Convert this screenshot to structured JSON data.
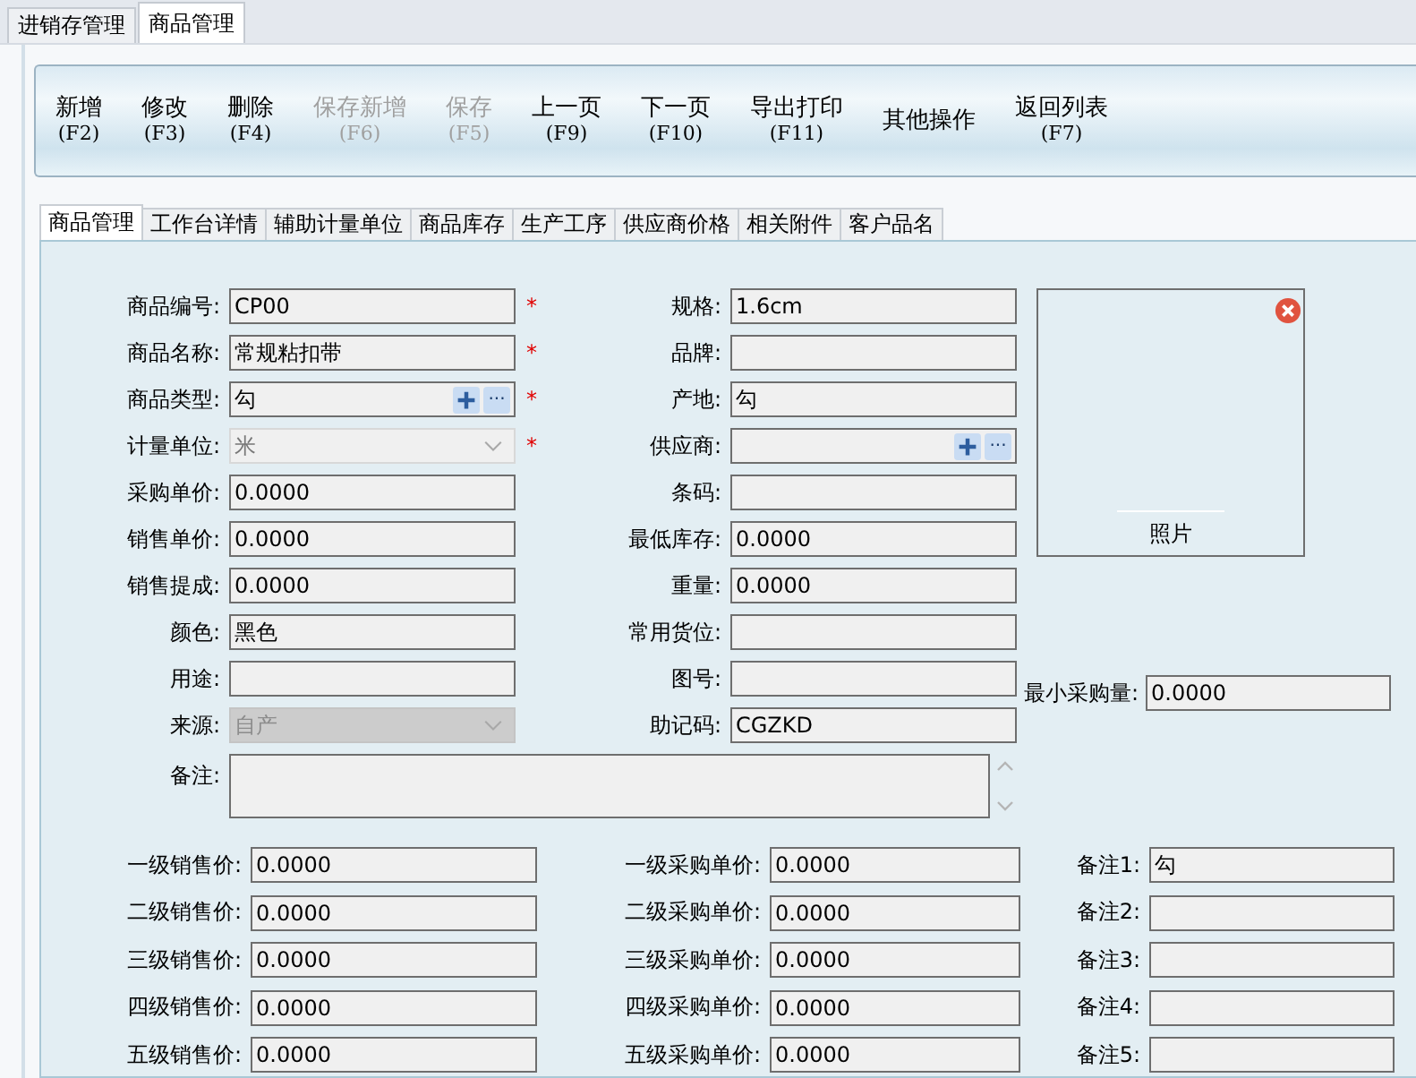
{
  "top_tabs": [
    {
      "label": "进销存管理",
      "selected": false
    },
    {
      "label": "商品管理",
      "selected": true
    }
  ],
  "toolbar": [
    {
      "label": "新增",
      "shortcut": "(F2)",
      "disabled": false
    },
    {
      "label": "修改",
      "shortcut": "(F3)",
      "disabled": false
    },
    {
      "label": "删除",
      "shortcut": "(F4)",
      "disabled": false
    },
    {
      "label": "保存新增",
      "shortcut": "(F6)",
      "disabled": true
    },
    {
      "label": "保存",
      "shortcut": "(F5)",
      "disabled": true
    },
    {
      "label": "上一页",
      "shortcut": "(F9)",
      "disabled": false
    },
    {
      "label": "下一页",
      "shortcut": "(F10)",
      "disabled": false
    },
    {
      "label": "导出打印",
      "shortcut": "(F11)",
      "disabled": false
    },
    {
      "label": "其他操作",
      "disabled": false
    },
    {
      "label": "返回列表",
      "shortcut": "(F7)",
      "disabled": false
    }
  ],
  "tabs": [
    {
      "label": "商品管理",
      "selected": true
    },
    {
      "label": "工作台详情",
      "selected": false
    },
    {
      "label": "辅助计量单位",
      "selected": false
    },
    {
      "label": "商品库存",
      "selected": false
    },
    {
      "label": "生产工序",
      "selected": false
    },
    {
      "label": "供应商价格",
      "selected": false
    },
    {
      "label": "相关附件",
      "selected": false
    },
    {
      "label": "客户品名",
      "selected": false
    }
  ],
  "required_mark": "*",
  "fields_left": [
    {
      "kind": "text",
      "label": "商品编号:",
      "value": "CP00",
      "required": true
    },
    {
      "kind": "text",
      "label": "商品名称:",
      "value": "常规粘扣带",
      "required": true
    },
    {
      "kind": "picker",
      "label": "商品类型:",
      "value": "勾",
      "browse": "...",
      "required": true
    },
    {
      "kind": "combo",
      "label": "计量单位:",
      "value": "米",
      "disabled": false,
      "required": true
    },
    {
      "kind": "text",
      "label": "采购单价:",
      "value": "0.0000",
      "required": false
    },
    {
      "kind": "text",
      "label": "销售单价:",
      "value": "0.0000",
      "required": false
    },
    {
      "kind": "text",
      "label": "销售提成:",
      "value": "0.0000",
      "required": false
    },
    {
      "kind": "text",
      "label": "颜色:",
      "value": "黑色",
      "required": false
    },
    {
      "kind": "text",
      "label": "用途:",
      "required": false
    },
    {
      "kind": "combo",
      "label": "来源:",
      "value": "自产",
      "disabled": true,
      "required": false
    }
  ],
  "fields_right": [
    {
      "kind": "text",
      "label": "规格:",
      "value": "1.6cm",
      "required": false
    },
    {
      "kind": "text",
      "label": "品牌:",
      "required": false
    },
    {
      "kind": "text",
      "label": "产地:",
      "value": "勾",
      "required": false
    },
    {
      "kind": "picker",
      "label": "供应商:",
      "browse": "...",
      "required": false
    },
    {
      "kind": "text",
      "label": "条码:",
      "required": false
    },
    {
      "kind": "text",
      "label": "最低库存:",
      "value": "0.0000",
      "required": false
    },
    {
      "kind": "text",
      "label": "重量:",
      "value": "0.0000",
      "required": false
    },
    {
      "kind": "text",
      "label": "常用货位:",
      "required": false
    },
    {
      "kind": "text",
      "label": "图号:",
      "required": false
    },
    {
      "kind": "text",
      "label": "助记码:",
      "value": "CGZKD",
      "required": false
    }
  ],
  "photo": {
    "label": "照片"
  },
  "min_purchase": {
    "label": "最小采购量:",
    "value": "0.0000"
  },
  "remark": {
    "label": "备注:"
  },
  "sale_prices": [
    {
      "label": "一级销售价:",
      "value": "0.0000"
    },
    {
      "label": "二级销售价:",
      "value": "0.0000"
    },
    {
      "label": "三级销售价:",
      "value": "0.0000"
    },
    {
      "label": "四级销售价:",
      "value": "0.0000"
    },
    {
      "label": "五级销售价:",
      "value": "0.0000"
    }
  ],
  "purchase_prices": [
    {
      "label": "一级采购单价:",
      "value": "0.0000"
    },
    {
      "label": "二级采购单价:",
      "value": "0.0000"
    },
    {
      "label": "三级采购单价:",
      "value": "0.0000"
    },
    {
      "label": "四级采购单价:",
      "value": "0.0000"
    },
    {
      "label": "五级采购单价:",
      "value": "0.0000"
    }
  ],
  "notes": [
    {
      "label": "备注1:",
      "value": "勾"
    },
    {
      "label": "备注2:"
    },
    {
      "label": "备注3:"
    },
    {
      "label": "备注4:"
    },
    {
      "label": "备注5:"
    }
  ]
}
